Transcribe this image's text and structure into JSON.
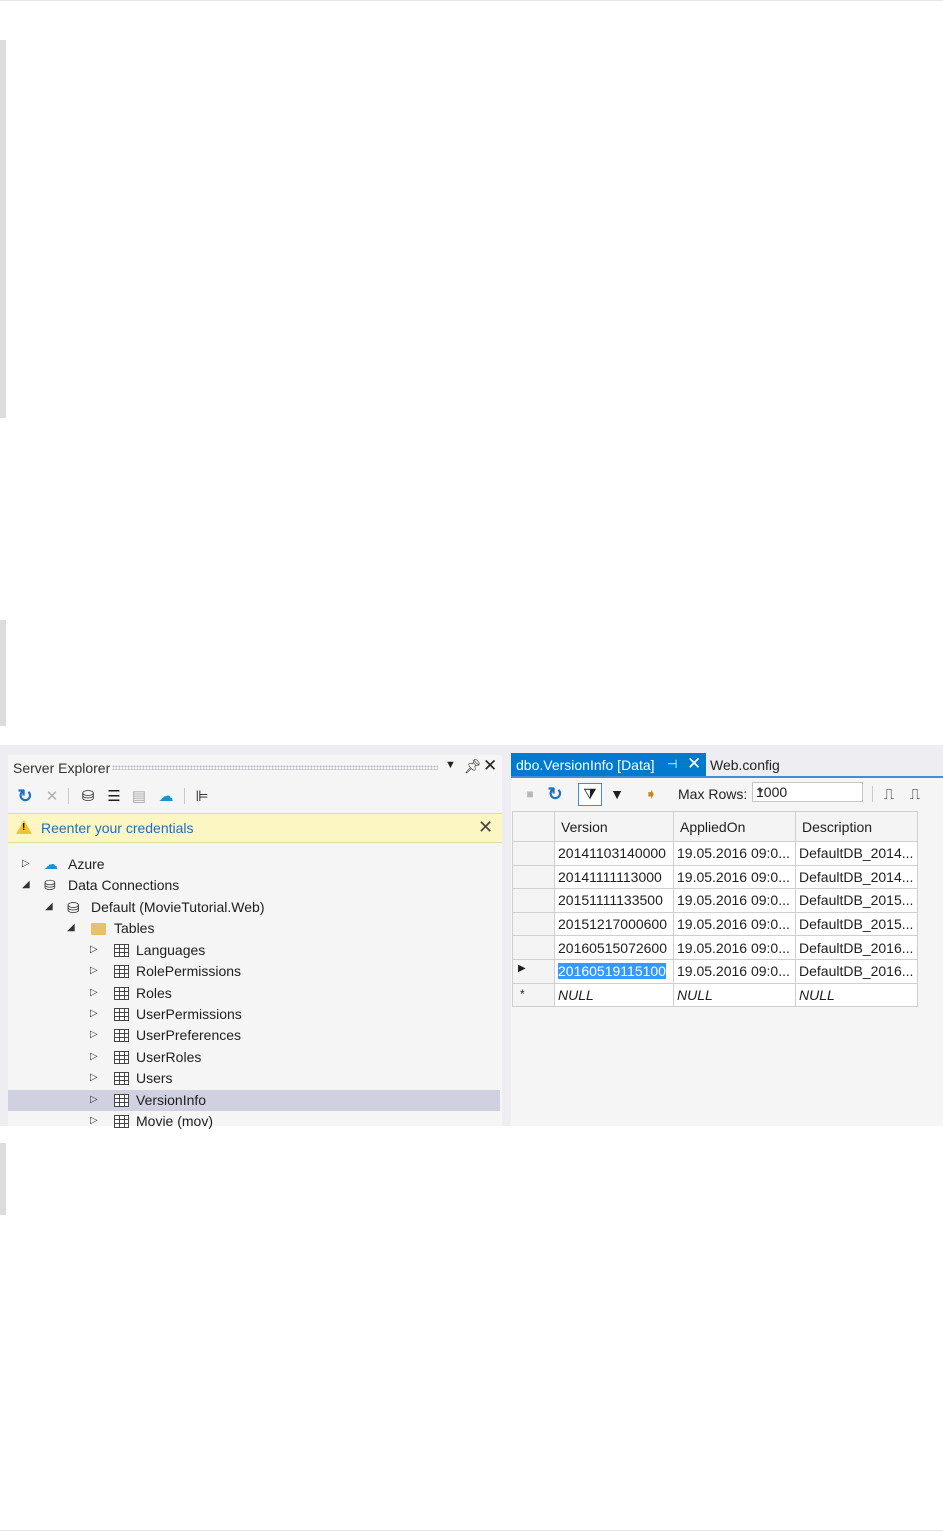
{
  "server_explorer": {
    "title": "Server Explorer",
    "info_message": "Reenter your credentials",
    "tree": [
      {
        "label": "Azure"
      },
      {
        "label": "Data Connections"
      },
      {
        "label": "Default (MovieTutorial.Web)"
      },
      {
        "label": "Tables"
      },
      {
        "label": "Languages"
      },
      {
        "label": "RolePermissions"
      },
      {
        "label": "Roles"
      },
      {
        "label": "UserPermissions"
      },
      {
        "label": "UserPreferences"
      },
      {
        "label": "UserRoles"
      },
      {
        "label": "Users"
      },
      {
        "label": "VersionInfo",
        "selected": true
      },
      {
        "label": "Movie (mov)"
      }
    ]
  },
  "data_window": {
    "tabs": [
      {
        "label": "dbo.VersionInfo [Data]",
        "active": true
      },
      {
        "label": "Web.config"
      }
    ],
    "max_rows_label": "Max Rows:",
    "max_rows_value": "1000",
    "columns": [
      "Version",
      "AppliedOn",
      "Description"
    ],
    "rows": [
      [
        "20141103140000",
        "19.05.2016 09:0...",
        "DefaultDB_2014..."
      ],
      [
        "20141111113000",
        "19.05.2016 09:0...",
        "DefaultDB_2014..."
      ],
      [
        "20151111133500",
        "19.05.2016 09:0...",
        "DefaultDB_2015..."
      ],
      [
        "20151217000600",
        "19.05.2016 09:0...",
        "DefaultDB_2015..."
      ],
      [
        "20160515072600",
        "19.05.2016 09:0...",
        "DefaultDB_2016..."
      ],
      [
        "20160519115100",
        "19.05.2016 09:0...",
        "DefaultDB_2016..."
      ],
      [
        "NULL",
        "NULL",
        "NULL"
      ]
    ]
  },
  "colors": {
    "accent": "#007acc",
    "info_bar": "#fcf6c2",
    "selection": "#3399ff"
  }
}
